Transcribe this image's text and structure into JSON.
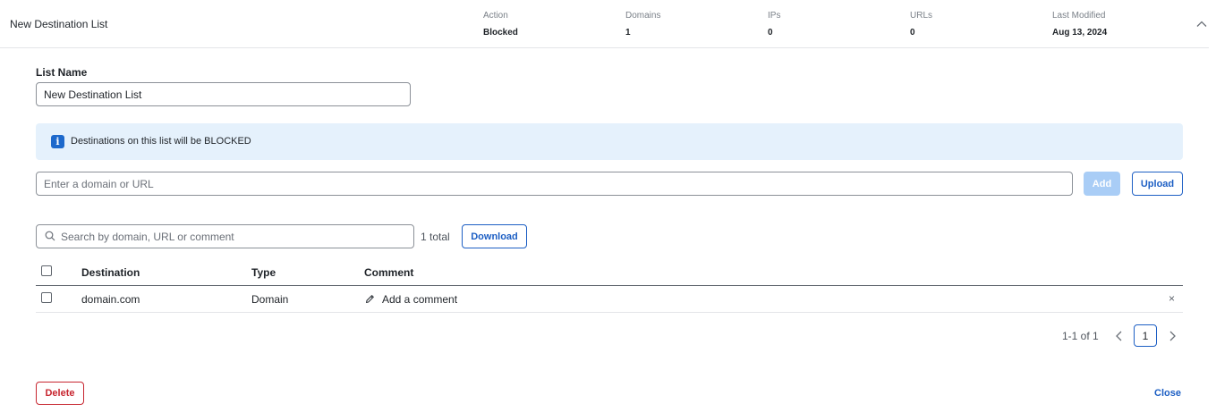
{
  "header": {
    "title": "New Destination List",
    "columns": [
      {
        "label": "Action",
        "value": "Blocked"
      },
      {
        "label": "Domains",
        "value": "1"
      },
      {
        "label": "IPs",
        "value": "0"
      },
      {
        "label": "URLs",
        "value": "0"
      },
      {
        "label": "Last Modified",
        "value": "Aug 13, 2024"
      }
    ],
    "collapse_icon": "chevron-up-icon"
  },
  "form": {
    "list_name_label": "List Name",
    "list_name_value": "New Destination List",
    "info_banner": "Destinations on this list will be BLOCKED",
    "info_icon": "info-icon",
    "domain_placeholder": "Enter a domain or URL",
    "add_label": "Add",
    "upload_label": "Upload"
  },
  "search": {
    "placeholder": "Search by domain, URL or comment",
    "total": "1 total",
    "download_label": "Download"
  },
  "table": {
    "headers": {
      "destination": "Destination",
      "type": "Type",
      "comment": "Comment"
    },
    "rows": [
      {
        "destination": "domain.com",
        "type": "Domain",
        "comment": "Add a comment",
        "remove": "×"
      }
    ]
  },
  "pagination": {
    "range": "1-1 of 1",
    "current_page": "1"
  },
  "footer": {
    "delete_label": "Delete",
    "close_label": "Close"
  },
  "colors": {
    "accent": "#1d5fc4",
    "danger": "#c7252f",
    "banner_bg": "#e5f1fc",
    "add_disabled": "#a9cdf6"
  }
}
